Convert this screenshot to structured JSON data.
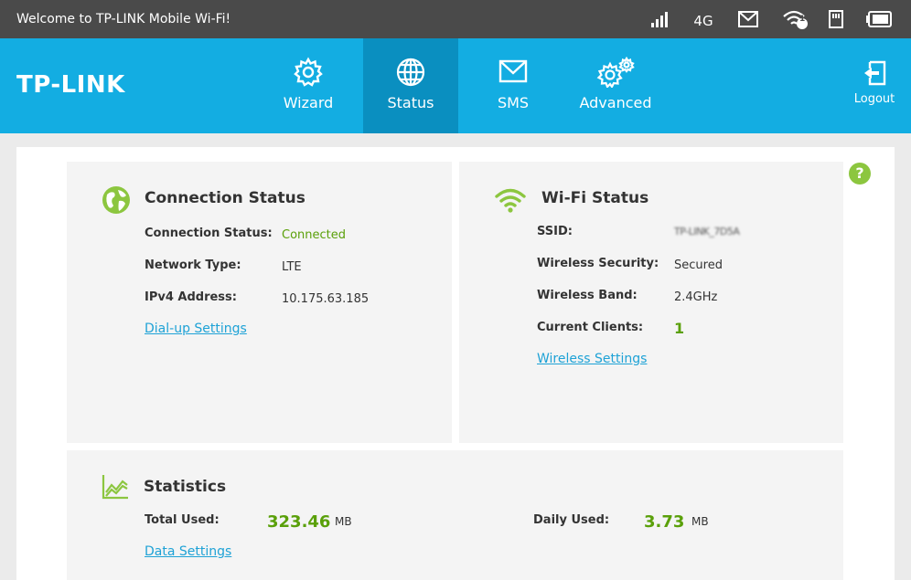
{
  "topbar": {
    "welcome": "Welcome to TP-LINK Mobile Wi-Fi!",
    "network": "4G",
    "wifi_clients_badge": "1"
  },
  "nav": {
    "logo": "TP-LINK",
    "items": [
      {
        "label": "Wizard",
        "icon": "gear-icon"
      },
      {
        "label": "Status",
        "icon": "globe-icon"
      },
      {
        "label": "SMS",
        "icon": "envelope-icon"
      },
      {
        "label": "Advanced",
        "icon": "gears-icon"
      }
    ],
    "logout": "Logout"
  },
  "help_label": "?",
  "connection": {
    "title": "Connection Status",
    "rows": [
      {
        "label": "Connection Status:",
        "value": "Connected"
      },
      {
        "label": "Network Type:",
        "value": "LTE"
      },
      {
        "label": "IPv4 Address:",
        "value": "10.175.63.185"
      }
    ],
    "link": "Dial-up Settings"
  },
  "wifi": {
    "title": "Wi-Fi Status",
    "rows": [
      {
        "label": "SSID:",
        "value": "TP-LINK_7D5A"
      },
      {
        "label": "Wireless Security:",
        "value": "Secured"
      },
      {
        "label": "Wireless Band:",
        "value": "2.4GHz"
      },
      {
        "label": "Current Clients:",
        "value": "1"
      }
    ],
    "link": "Wireless Settings"
  },
  "statistics": {
    "title": "Statistics",
    "total_label": "Total Used:",
    "total_value": "323.46",
    "total_unit": "MB",
    "daily_label": "Daily Used:",
    "daily_value": "3.73",
    "daily_unit": "MB",
    "link": "Data Settings"
  },
  "colors": {
    "accent": "#13ade2",
    "active_tab": "#0a8fc0",
    "topbar": "#4a4a4a",
    "green": "#5aa00a",
    "link": "#1ea2d6"
  }
}
